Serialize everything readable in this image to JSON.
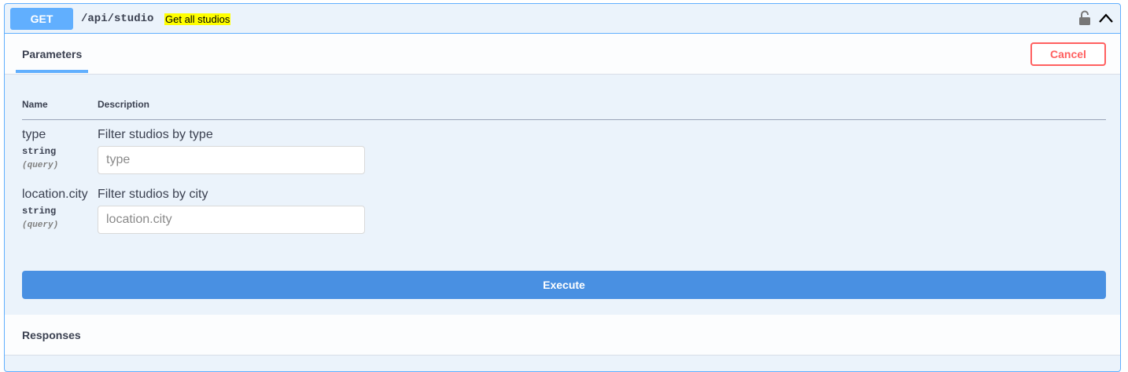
{
  "operation": {
    "method": "GET",
    "path": "/api/studio",
    "summary": "Get all studios"
  },
  "icons": {
    "lock": "unlocked-padlock",
    "toggle": "chevron-up"
  },
  "tabs": {
    "parameters_label": "Parameters"
  },
  "buttons": {
    "cancel_label": "Cancel",
    "execute_label": "Execute"
  },
  "table": {
    "headers": {
      "name": "Name",
      "description": "Description"
    },
    "params": [
      {
        "name": "type",
        "type": "string",
        "in": "(query)",
        "description": "Filter studios by type",
        "placeholder": "type",
        "value": ""
      },
      {
        "name": "location.city",
        "type": "string",
        "in": "(query)",
        "description": "Filter studios by city",
        "placeholder": "location.city",
        "value": ""
      }
    ]
  },
  "responses": {
    "title": "Responses"
  },
  "colors": {
    "get": "#61affe",
    "cancel": "#ff6060",
    "execute": "#4990e2",
    "summary_highlight": "#ffff00"
  }
}
